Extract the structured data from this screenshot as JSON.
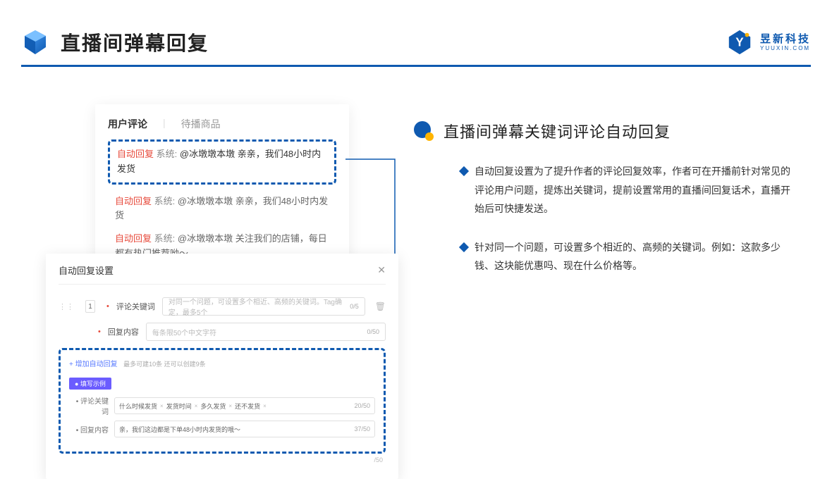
{
  "header": {
    "title": "直播间弹幕回复",
    "brand_name": "昱新科技",
    "brand_url": "YUUXIN.COM"
  },
  "comments": {
    "tab_active": "用户评论",
    "tab_inactive": "待播商品",
    "highlight_tag": "自动回复",
    "highlight_sys": "系统:",
    "highlight_text": "@冰墩墩本墩 亲亲，我们48小时内发货",
    "row2_tag": "自动回复",
    "row2_sys": "系统:",
    "row2_text": "@冰墩墩本墩 亲亲，我们48小时内发货",
    "row3_tag": "自动回复",
    "row3_sys": "系统:",
    "row3_text": "@冰墩墩本墩 关注我们的店铺，每日都有热门推荐呦～"
  },
  "settings": {
    "title": "自动回复设置",
    "num": "1",
    "kw_label": "评论关键词",
    "kw_placeholder": "对同一个问题，可设置多个相近、高频的关键词。Tag确定，最多5个",
    "kw_count": "0/5",
    "content_label": "回复内容",
    "content_placeholder": "每条限50个中文字符",
    "content_count": "0/50",
    "add_link": "+ 增加自动回复",
    "add_hint": "最多可建10条 还可以创建9条",
    "ex_badge": "● 填写示例",
    "ex_kw_label": "• 评论关键词",
    "ex_chip1": "什么时候发货",
    "ex_chip2": "发货时间",
    "ex_chip3": "多久发货",
    "ex_chip4": "还不发货",
    "ex_kw_count": "20/50",
    "ex_ct_label": "• 回复内容",
    "ex_ct_value": "亲，我们这边都是下单48小时内发货的哦～",
    "ex_ct_count": "37/50",
    "outer_count": "/50"
  },
  "right": {
    "subtitle": "直播间弹幕关键词评论自动回复",
    "b1": "自动回复设置为了提升作者的评论回复效率，作者可在开播前针对常见的评论用户问题，提炼出关键词，提前设置常用的直播间回复话术，直播开始后可快捷发送。",
    "b2": "针对同一个问题，可设置多个相近的、高频的关键词。例如：这款多少钱、这块能优惠吗、现在什么价格等。"
  }
}
